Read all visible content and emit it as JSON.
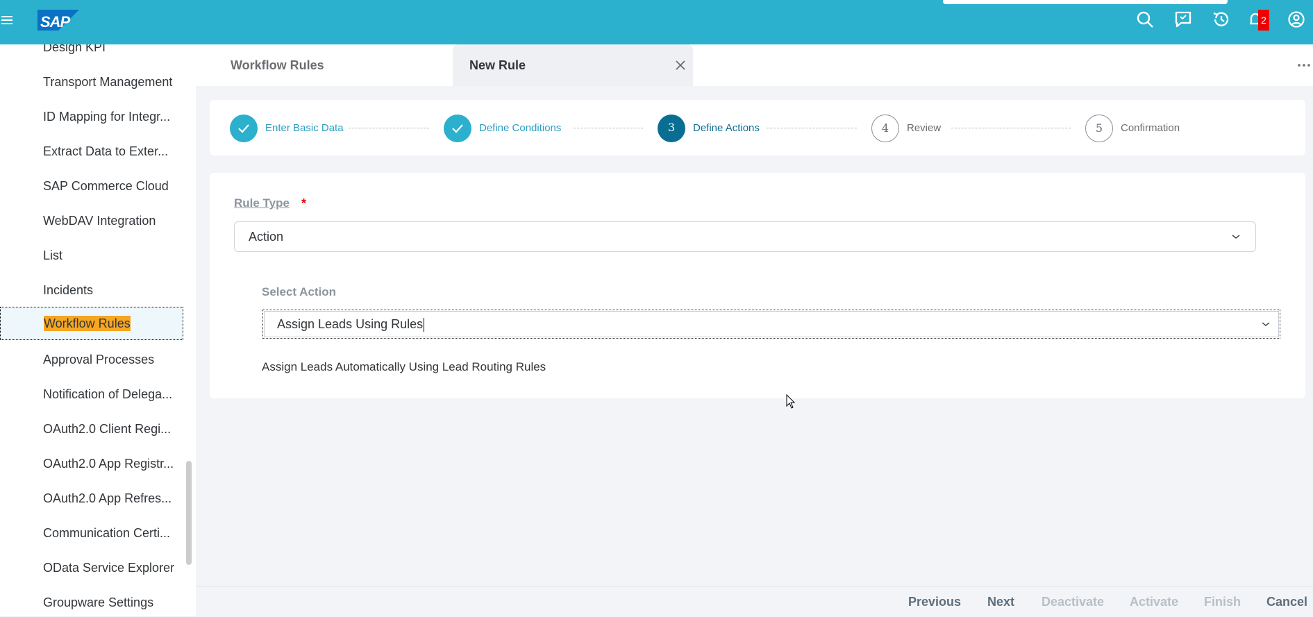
{
  "shell": {
    "brand": "SAP",
    "notification_count": "2",
    "colors": {
      "shell_bg": "#2bb0cd",
      "badge": "#e00000"
    },
    "icons": [
      "menu-icon",
      "search-icon",
      "chat-icon",
      "history-icon",
      "bell-icon",
      "user-profile-icon"
    ]
  },
  "sidebar": {
    "items": [
      {
        "label": "Design KPI"
      },
      {
        "label": "Transport Management"
      },
      {
        "label": "ID Mapping for Integr..."
      },
      {
        "label": "Extract Data to Exter..."
      },
      {
        "label": "SAP Commerce Cloud"
      },
      {
        "label": "WebDAV Integration"
      },
      {
        "label": "List"
      },
      {
        "label": "Incidents"
      },
      {
        "label": "Workflow Rules",
        "active": true
      },
      {
        "label": "Approval Processes"
      },
      {
        "label": "Notification of Delega..."
      },
      {
        "label": "OAuth2.0 Client Regi..."
      },
      {
        "label": "OAuth2.0 App Registr..."
      },
      {
        "label": "OAuth2.0 App Refres..."
      },
      {
        "label": "Communication Certi..."
      },
      {
        "label": "OData Service Explorer"
      },
      {
        "label": "Groupware Settings"
      }
    ]
  },
  "tabs": [
    {
      "label": "Workflow Rules"
    },
    {
      "label": "New Rule",
      "closable": true
    }
  ],
  "wizard": {
    "steps": [
      {
        "label": "Enter Basic Data",
        "state": "done",
        "number": ""
      },
      {
        "label": "Define Conditions",
        "state": "done",
        "number": ""
      },
      {
        "label": "Define Actions",
        "state": "current",
        "number": "3"
      },
      {
        "label": "Review",
        "state": "todo",
        "number": "4"
      },
      {
        "label": "Confirmation",
        "state": "todo",
        "number": "5"
      }
    ]
  },
  "form": {
    "rule_type": {
      "label": "Rule Type",
      "required_mark": "*",
      "value": "Action"
    },
    "select_action": {
      "label": "Select Action",
      "value": "Assign Leads Using Rules"
    },
    "action_description": "Assign Leads Automatically Using Lead Routing Rules"
  },
  "footer": {
    "buttons": [
      {
        "label": "Previous",
        "enabled": true
      },
      {
        "label": "Next",
        "enabled": true
      },
      {
        "label": "Deactivate",
        "enabled": false
      },
      {
        "label": "Activate",
        "enabled": false
      },
      {
        "label": "Finish",
        "enabled": false
      },
      {
        "label": "Cancel",
        "enabled": true
      }
    ]
  }
}
